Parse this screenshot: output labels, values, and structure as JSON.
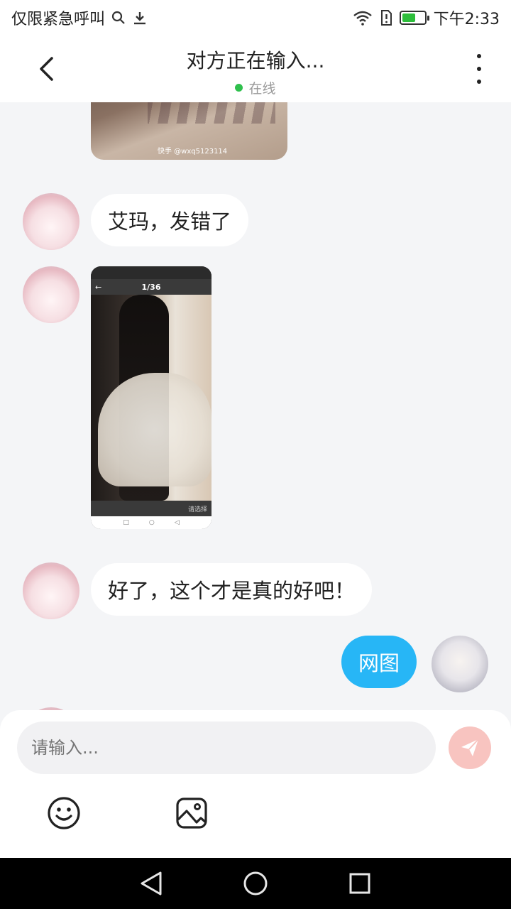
{
  "status": {
    "carrier": "仅限紧急呼叫",
    "time": "下午2:33"
  },
  "header": {
    "title": "对方正在输入...",
    "presence": "在线",
    "presence_color": "#2fc04d"
  },
  "messages": [
    {
      "sender": "other",
      "type": "image",
      "watermark": "快手 @wxq5123114"
    },
    {
      "sender": "other",
      "type": "text",
      "text": "艾玛，发错了"
    },
    {
      "sender": "other",
      "type": "image",
      "screenshot": {
        "counter": "1/36",
        "footer": "请选择"
      }
    },
    {
      "sender": "other",
      "type": "text",
      "text": "好了，这个才是真的好吧！"
    },
    {
      "sender": "self",
      "type": "text",
      "text": "网图"
    }
  ],
  "composer": {
    "placeholder": "请输入..."
  },
  "colors": {
    "self_bubble": "#27b6f6",
    "send_button": "#f8c4c0"
  },
  "icons": [
    "back-icon",
    "more-icon",
    "send-icon",
    "emoji-icon",
    "image-icon",
    "nav-back-icon",
    "nav-home-icon",
    "nav-recents-icon"
  ]
}
